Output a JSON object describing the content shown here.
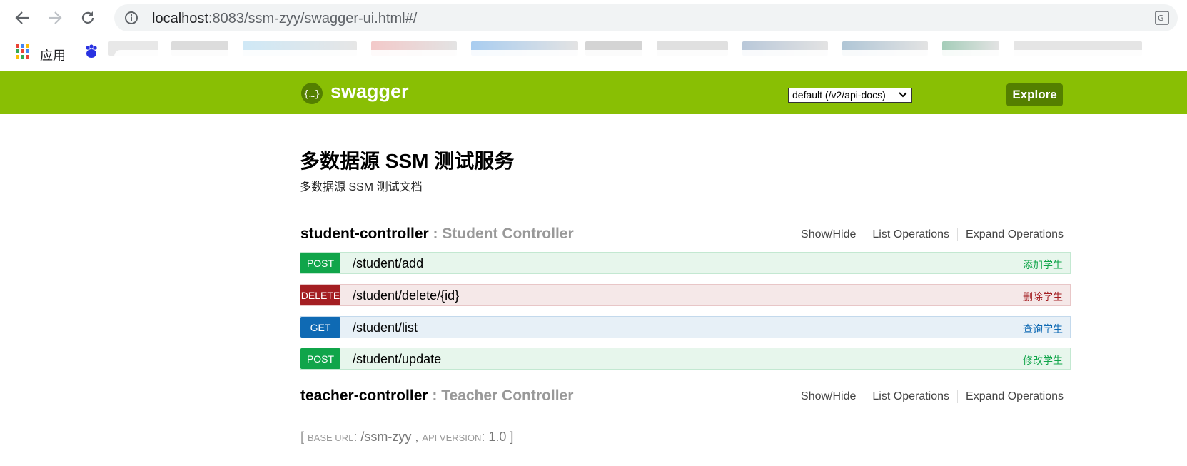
{
  "browser": {
    "url_host": "localhost",
    "url_rest": ":8083/ssm-zyy/swagger-ui.html#/",
    "bookmarks_apps_label": "应用"
  },
  "swagger": {
    "logo_text": "swagger",
    "spec_select": "default (/v2/api-docs)",
    "explore_label": "Explore",
    "brand_color": "#89bf04"
  },
  "info": {
    "title": "多数据源 SSM 测试服务",
    "description": "多数据源 SSM 测试文档"
  },
  "resources": [
    {
      "name": "student-controller",
      "description": " : Student Controller",
      "show_hide": "Show/Hide",
      "list_ops": "List Operations",
      "expand_ops": "Expand Operations",
      "operations": [
        {
          "method": "POST",
          "path": "/student/add",
          "summary": "添加学生"
        },
        {
          "method": "DELETE",
          "path": "/student/delete/{id}",
          "summary": "删除学生"
        },
        {
          "method": "GET",
          "path": "/student/list",
          "summary": "查询学生"
        },
        {
          "method": "POST",
          "path": "/student/update",
          "summary": "修改学生"
        }
      ]
    },
    {
      "name": "teacher-controller",
      "description": " : Teacher Controller",
      "show_hide": "Show/Hide",
      "list_ops": "List Operations",
      "expand_ops": "Expand Operations"
    }
  ],
  "footer": {
    "open": "[ ",
    "base_url_label": "BASE URL",
    "base_url": ": /ssm-zyy , ",
    "api_version_label": "API VERSION",
    "api_version": ": 1.0 ]"
  }
}
